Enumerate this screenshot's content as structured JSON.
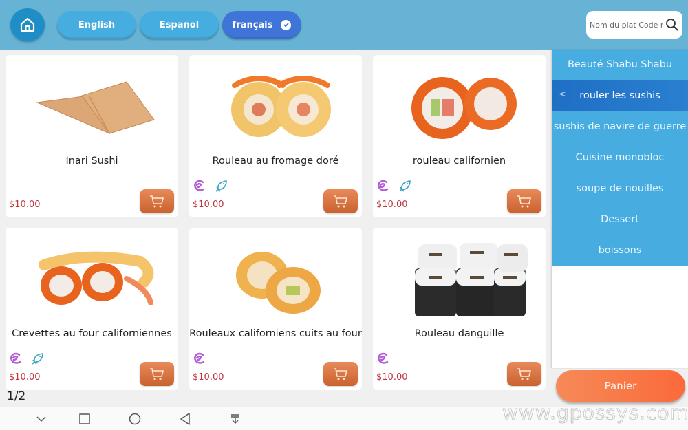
{
  "header": {
    "home_icon": "home-icon",
    "languages": [
      {
        "label": "English",
        "active": false
      },
      {
        "label": "Español",
        "active": false
      },
      {
        "label": "français",
        "active": true
      }
    ],
    "search": {
      "placeholder": "Nom du plat Code r",
      "icon": "search-icon"
    }
  },
  "products": [
    {
      "name": "Inari Sushi",
      "price": "$10.00",
      "tags": [],
      "image": "inari-sushi-image"
    },
    {
      "name": "Rouleau au fromage doré",
      "price": "$10.00",
      "tags": [
        "shrimp-icon",
        "fish-icon"
      ],
      "image": "cheese-roll-image"
    },
    {
      "name": "rouleau californien",
      "price": "$10.00",
      "tags": [
        "shrimp-icon",
        "fish-icon"
      ],
      "image": "california-roll-image"
    },
    {
      "name": "Crevettes au four californiennes",
      "price": "$10.00",
      "tags": [
        "shrimp-icon",
        "fish-icon"
      ],
      "image": "baked-shrimp-roll-image"
    },
    {
      "name": "Rouleaux californiens cuits au four",
      "price": "$10.00",
      "tags": [
        "shrimp-icon"
      ],
      "image": "baked-california-roll-image"
    },
    {
      "name": "Rouleau danguille",
      "price": "$10.00",
      "tags": [
        "shrimp-icon"
      ],
      "image": "eel-roll-image"
    }
  ],
  "pagination": {
    "text": "1/2"
  },
  "sidebar": {
    "categories": [
      {
        "label": "Beauté Shabu Shabu",
        "active": false
      },
      {
        "label": "rouler les sushis",
        "active": true
      },
      {
        "label": "sushis de navire de guerre",
        "active": false
      },
      {
        "label": "Cuisine monobloc",
        "active": false
      },
      {
        "label": "soupe de nouilles",
        "active": false
      },
      {
        "label": "Dessert",
        "active": false
      },
      {
        "label": "boissons",
        "active": false
      }
    ],
    "back_glyph": "<"
  },
  "cart": {
    "label": "Panier"
  },
  "navbar": {
    "items": [
      "chevron-down-icon",
      "recent-apps-icon",
      "home-circle-icon",
      "back-icon",
      "notification-pull-icon"
    ]
  },
  "watermark": "www.gpossys.com",
  "colors": {
    "header": "#67b3d6",
    "active_lang": "#3f75d8",
    "category": "#47ade0",
    "price": "#c0343d",
    "cart_button": "#d56e3d",
    "panier": "#fb6a3a"
  }
}
